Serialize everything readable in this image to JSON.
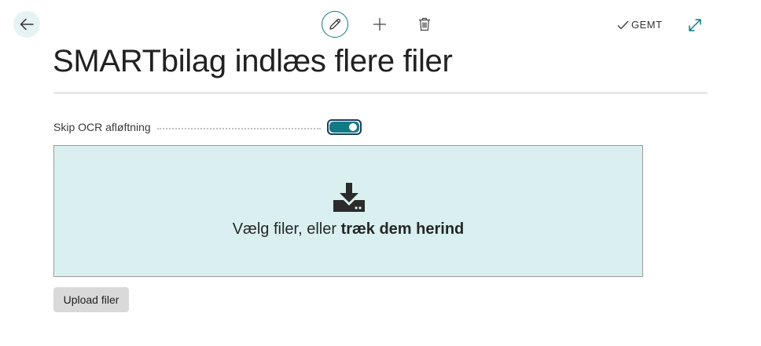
{
  "header": {
    "saved_label": "GEMT"
  },
  "page": {
    "title": "SMARTbilag indlæs flere filer"
  },
  "fields": {
    "skip_ocr": {
      "label": "Skip OCR afløftning",
      "enabled": true
    }
  },
  "dropzone": {
    "text_regular": "Vælg filer, eller ",
    "text_bold": "træk dem herind",
    "icon": "download-tray-icon"
  },
  "actions": {
    "upload_label": "Upload filer"
  },
  "icons": {
    "back": "arrow-left-icon",
    "edit": "pencil-icon",
    "new": "plus-icon",
    "delete": "trash-icon",
    "saved": "checkmark-icon",
    "expand": "expand-icon"
  },
  "colors": {
    "accent": "#127a84",
    "back_button_bg": "#e6f2f3",
    "dropzone_bg": "#daf0f0",
    "button_bg": "#d9d9d9"
  }
}
